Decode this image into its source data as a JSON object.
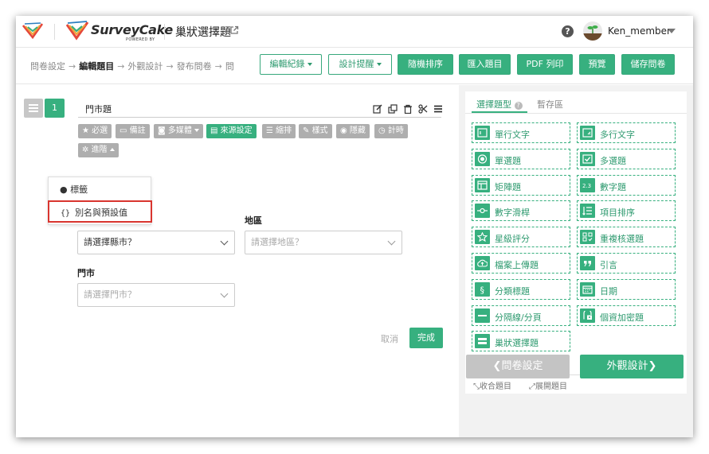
{
  "header": {
    "brand": "SurveyCake",
    "brand_sub": "POWERED BY",
    "survey_title": "巢狀選擇題",
    "username": "Ken_member",
    "help": "?"
  },
  "toolbar": {
    "crumbs": [
      "問卷設定",
      "編輯題目",
      "外觀設計",
      "發布問卷",
      "問"
    ],
    "arrow": "→",
    "edit_log": "編輯紀錄",
    "design_reminder": "設計提醒",
    "shuffle": "隨機排序",
    "import": "匯入題目",
    "pdf": "PDF 列印",
    "preview": "預覽",
    "save": "儲存問卷"
  },
  "question": {
    "number": "1",
    "title": "門市題",
    "chips": {
      "required": "必選",
      "note": "備註",
      "media": "多媒體",
      "source": "來源設定",
      "indent": "縮排",
      "style": "樣式",
      "hide": "隱藏",
      "timer": "計時",
      "advanced": "進階"
    },
    "dropdown": {
      "tag": "標籤",
      "alias": "別名與預設值"
    },
    "fields": {
      "city_select": "請選擇縣市？",
      "region_label": "地區",
      "region_placeholder": "請選擇地區？",
      "store_label": "門市",
      "store_placeholder": "請選擇門市？"
    },
    "cancel": "取消",
    "done": "完成"
  },
  "right_panel": {
    "tab_types": "選擇題型",
    "tab_temp": "暫存區",
    "types": [
      "單行文字",
      "多行文字",
      "單選題",
      "多選題",
      "矩陣題",
      "數字題",
      "數字滑桿",
      "項目排序",
      "星級評分",
      "重複核選題",
      "檔案上傳題",
      "引言",
      "分類標題",
      "日期",
      "分隔線/分頁",
      "個資加密題",
      "巢狀選擇題"
    ],
    "icons": [
      "single-line-text-icon",
      "multi-line-text-icon",
      "radio-icon",
      "checkbox-icon",
      "matrix-icon",
      "number-icon",
      "slider-icon",
      "ordering-icon",
      "star-icon",
      "repeat-check-icon",
      "upload-icon",
      "quote-icon",
      "section-icon",
      "calendar-icon",
      "divider-icon",
      "lock-icon",
      "nested-select-icon"
    ],
    "number_icon_text": "2.3",
    "collapse": "收合題目",
    "expand": "展開題目"
  },
  "footer": {
    "prev": "問卷設定",
    "next": "外觀設計"
  },
  "colors": {
    "accent": "#37b07f",
    "highlight": "#d9352f",
    "chip_gray": "#aeaeae"
  }
}
